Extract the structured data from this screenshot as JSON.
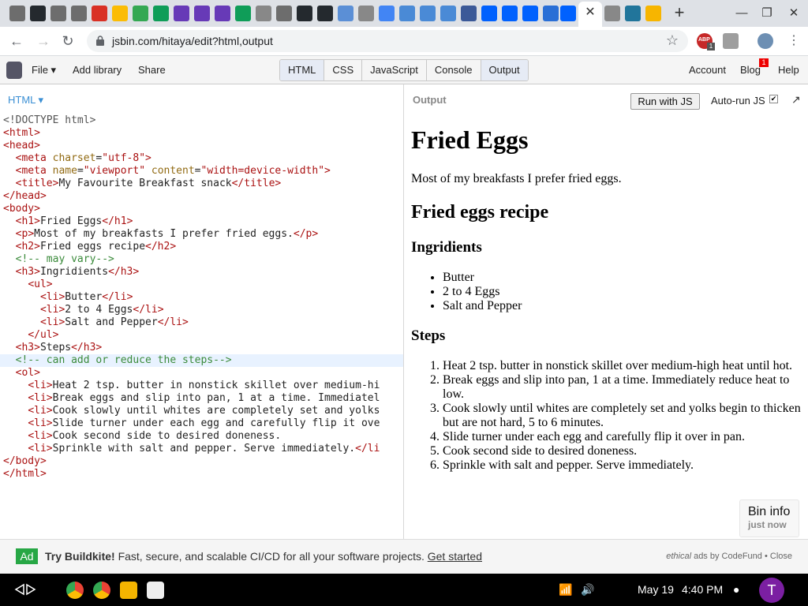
{
  "browser": {
    "url": "jsbin.com/hitaya/edit?html,output",
    "active_tab_close": "✕",
    "new_tab": "+",
    "extension_badge": "ABP",
    "extension_count": "1"
  },
  "jsbin": {
    "menu": {
      "file": "File ▾",
      "add_library": "Add library",
      "share": "Share"
    },
    "panels": [
      "HTML",
      "CSS",
      "JavaScript",
      "Console",
      "Output"
    ],
    "right_menu": {
      "account": "Account",
      "blog": "Blog",
      "blog_badge": "1",
      "help": "Help"
    }
  },
  "editor": {
    "panel_label": "HTML ▾",
    "lines": [
      "<!DOCTYPE html>",
      "<html>",
      "<head>",
      "  <meta charset=\"utf-8\">",
      "  <meta name=\"viewport\" content=\"width=device-width\">",
      "  <title>My Favourite Breakfast snack</title>",
      "</head>",
      "<body>",
      "  <h1>Fried Eggs</h1>",
      "  <p>Most of my breakfasts I prefer fried eggs.</p>",
      "  <h2>Fried eggs recipe</h2>",
      "  <!-- may vary-->",
      "  <h3>Ingridients</h3>",
      "    <ul>",
      "      <li>Butter</li>",
      "      <li>2 to 4 Eggs</li>",
      "      <li>Salt and Pepper</li>",
      "    </ul>",
      "  <h3>Steps</h3>",
      "  <!-- can add or reduce the steps-->",
      "  <ol>",
      "    <li>Heat 2 tsp. butter in nonstick skillet over medium-hi",
      "    <li>Break eggs and slip into pan, 1 at a time. Immediatel",
      "    <li>Cook slowly until whites are completely set and yolks",
      "    <li>Slide turner under each egg and carefully flip it ove",
      "    <li>Cook second side to desired doneness.",
      "    <li>Sprinkle with salt and pepper. Serve immediately.</li",
      "</body>",
      "</html>"
    ]
  },
  "output": {
    "label": "Output",
    "run_button": "Run with JS",
    "autorun": "Auto-run JS",
    "autorun_checked": "✔",
    "popout": "↗",
    "h1": "Fried Eggs",
    "intro": "Most of my breakfasts I prefer fried eggs.",
    "h2": "Fried eggs recipe",
    "ingredients_heading": "Ingridients",
    "ingredients": [
      "Butter",
      "2 to 4 Eggs",
      "Salt and Pepper"
    ],
    "steps_heading": "Steps",
    "steps": [
      "Heat 2 tsp. butter in nonstick skillet over medium-high heat until hot.",
      "Break eggs and slip into pan, 1 at a time. Immediately reduce heat to low.",
      "Cook slowly until whites are completely set and yolks begin to thicken but are not hard, 5 to 6 minutes.",
      "Slide turner under each egg and carefully flip it over in pan.",
      "Cook second side to desired doneness.",
      "Sprinkle with salt and pepper. Serve immediately."
    ],
    "bin_info": "Bin info",
    "bin_time": "just now"
  },
  "ad": {
    "badge": "Ad",
    "title": "Try Buildkite!",
    "text": " Fast, secure, and scalable CI/CD for all your software projects. ",
    "link": "Get started",
    "right_prefix": "ethical",
    "right_text": " ads by CodeFund • Close"
  },
  "shelf": {
    "date": "May 19",
    "time": "4:40 PM",
    "avatar_letter": "T"
  }
}
